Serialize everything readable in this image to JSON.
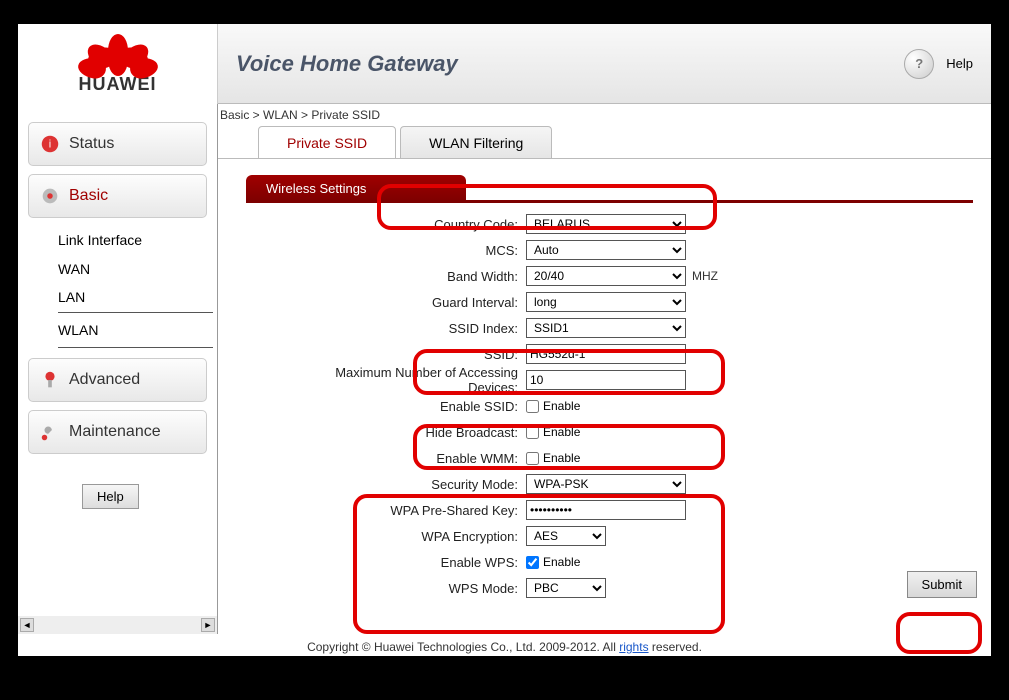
{
  "brand": {
    "name": "HUAWEI",
    "app_title": "Voice Home Gateway",
    "help": "Help"
  },
  "sidebar": {
    "items": [
      {
        "label": "Status"
      },
      {
        "label": "Basic"
      },
      {
        "label": "Advanced"
      },
      {
        "label": "Maintenance"
      }
    ],
    "basic_sub": [
      "Link Interface",
      "WAN",
      "LAN",
      "WLAN"
    ],
    "help_btn": "Help"
  },
  "breadcrumb": "Basic > WLAN > Private SSID",
  "tabs": [
    "Private SSID",
    "WLAN Filtering"
  ],
  "section_title": "Wireless Settings",
  "form": {
    "country_code": {
      "label": "Country Code:",
      "value": "BELARUS"
    },
    "mcs": {
      "label": "MCS:",
      "value": "Auto"
    },
    "band_width": {
      "label": "Band Width:",
      "value": "20/40",
      "unit": "MHZ"
    },
    "guard_interval": {
      "label": "Guard Interval:",
      "value": "long"
    },
    "ssid_index": {
      "label": "SSID Index:",
      "value": "SSID1"
    },
    "ssid": {
      "label": "SSID:",
      "value": "HG552d-1"
    },
    "max_devices": {
      "label": "Maximum Number of Accessing Devices:",
      "value": "10"
    },
    "enable_ssid": {
      "label": "Enable SSID:",
      "box": "Enable"
    },
    "hide_broadcast": {
      "label": "Hide Broadcast:",
      "box": "Enable"
    },
    "enable_wmm": {
      "label": "Enable WMM:",
      "box": "Enable"
    },
    "security_mode": {
      "label": "Security Mode:",
      "value": "WPA-PSK"
    },
    "wpa_key": {
      "label": "WPA Pre-Shared Key:",
      "value": "••••••••••"
    },
    "wpa_encryption": {
      "label": "WPA Encryption:",
      "value": "AES"
    },
    "enable_wps": {
      "label": "Enable WPS:",
      "box": "Enable"
    },
    "wps_mode": {
      "label": "WPS Mode:",
      "value": "PBC"
    }
  },
  "submit": "Submit",
  "footer": {
    "pre": "Copyright © Huawei Technologies Co., Ltd. 2009-2012. All ",
    "link": "rights",
    "post": " reserved."
  }
}
